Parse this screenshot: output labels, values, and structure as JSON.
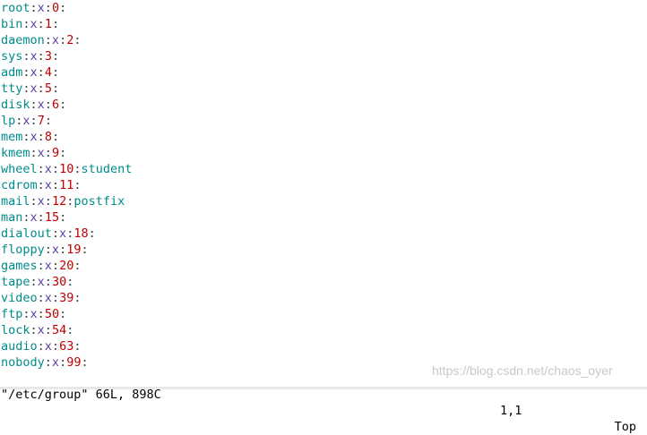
{
  "lines": [
    {
      "name": "root",
      "gid": "0",
      "users": ""
    },
    {
      "name": "bin",
      "gid": "1",
      "users": ""
    },
    {
      "name": "daemon",
      "gid": "2",
      "users": ""
    },
    {
      "name": "sys",
      "gid": "3",
      "users": ""
    },
    {
      "name": "adm",
      "gid": "4",
      "users": ""
    },
    {
      "name": "tty",
      "gid": "5",
      "users": ""
    },
    {
      "name": "disk",
      "gid": "6",
      "users": ""
    },
    {
      "name": "lp",
      "gid": "7",
      "users": ""
    },
    {
      "name": "mem",
      "gid": "8",
      "users": ""
    },
    {
      "name": "kmem",
      "gid": "9",
      "users": ""
    },
    {
      "name": "wheel",
      "gid": "10",
      "users": "student"
    },
    {
      "name": "cdrom",
      "gid": "11",
      "users": ""
    },
    {
      "name": "mail",
      "gid": "12",
      "users": "postfix"
    },
    {
      "name": "man",
      "gid": "15",
      "users": ""
    },
    {
      "name": "dialout",
      "gid": "18",
      "users": ""
    },
    {
      "name": "floppy",
      "gid": "19",
      "users": ""
    },
    {
      "name": "games",
      "gid": "20",
      "users": ""
    },
    {
      "name": "tape",
      "gid": "30",
      "users": ""
    },
    {
      "name": "video",
      "gid": "39",
      "users": ""
    },
    {
      "name": "ftp",
      "gid": "50",
      "users": ""
    },
    {
      "name": "lock",
      "gid": "54",
      "users": ""
    },
    {
      "name": "audio",
      "gid": "63",
      "users": ""
    },
    {
      "name": "nobody",
      "gid": "99",
      "users": ""
    }
  ],
  "password_field": "x",
  "separator": ":",
  "status": {
    "file_info": "\"/etc/group\" 66L, 898C",
    "cursor_position": "1,1",
    "scroll_position": "Top"
  },
  "watermark": "https://blog.csdn.net/chaos_oyer"
}
